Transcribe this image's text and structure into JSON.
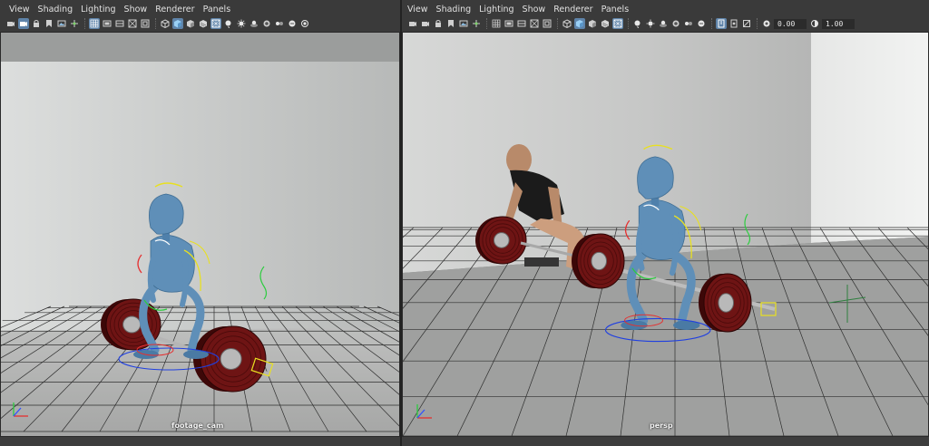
{
  "left_panel": {
    "menu": [
      "View",
      "Shading",
      "Lighting",
      "Show",
      "Renderer",
      "Panels"
    ],
    "camera_label": "footage_cam"
  },
  "right_panel": {
    "menu": [
      "View",
      "Shading",
      "Lighting",
      "Show",
      "Renderer",
      "Panels"
    ],
    "camera_label": "persp",
    "gamma_exposure": "0.00",
    "gamma_value": "1.00"
  },
  "icons": {
    "toolbar": [
      "camera-icon",
      "camera-select-icon",
      "camera-lock-icon",
      "bookmark-icon",
      "image-plane-icon",
      "move-camera-icon",
      "grid-icon",
      "film-gate-icon",
      "resolution-gate-icon",
      "field-chart-icon",
      "safe-action-icon",
      "wireframe-icon",
      "smooth-shade-icon",
      "default-material-icon",
      "textured-icon",
      "lights-icon",
      "shadows-icon",
      "ambient-occlusion-icon",
      "motion-blur-icon",
      "anti-aliasing-icon",
      "depth-of-field-icon",
      "isolate-select-icon",
      "xray-icon",
      "xray-joints-icon",
      "backface-icon",
      "color-manage-icon"
    ]
  },
  "colors": {
    "menu_text": "#e0e0e0",
    "active_button": "#5e83a9",
    "rig_blue": "#5f8fb8",
    "plate_red": "#6e1414"
  }
}
